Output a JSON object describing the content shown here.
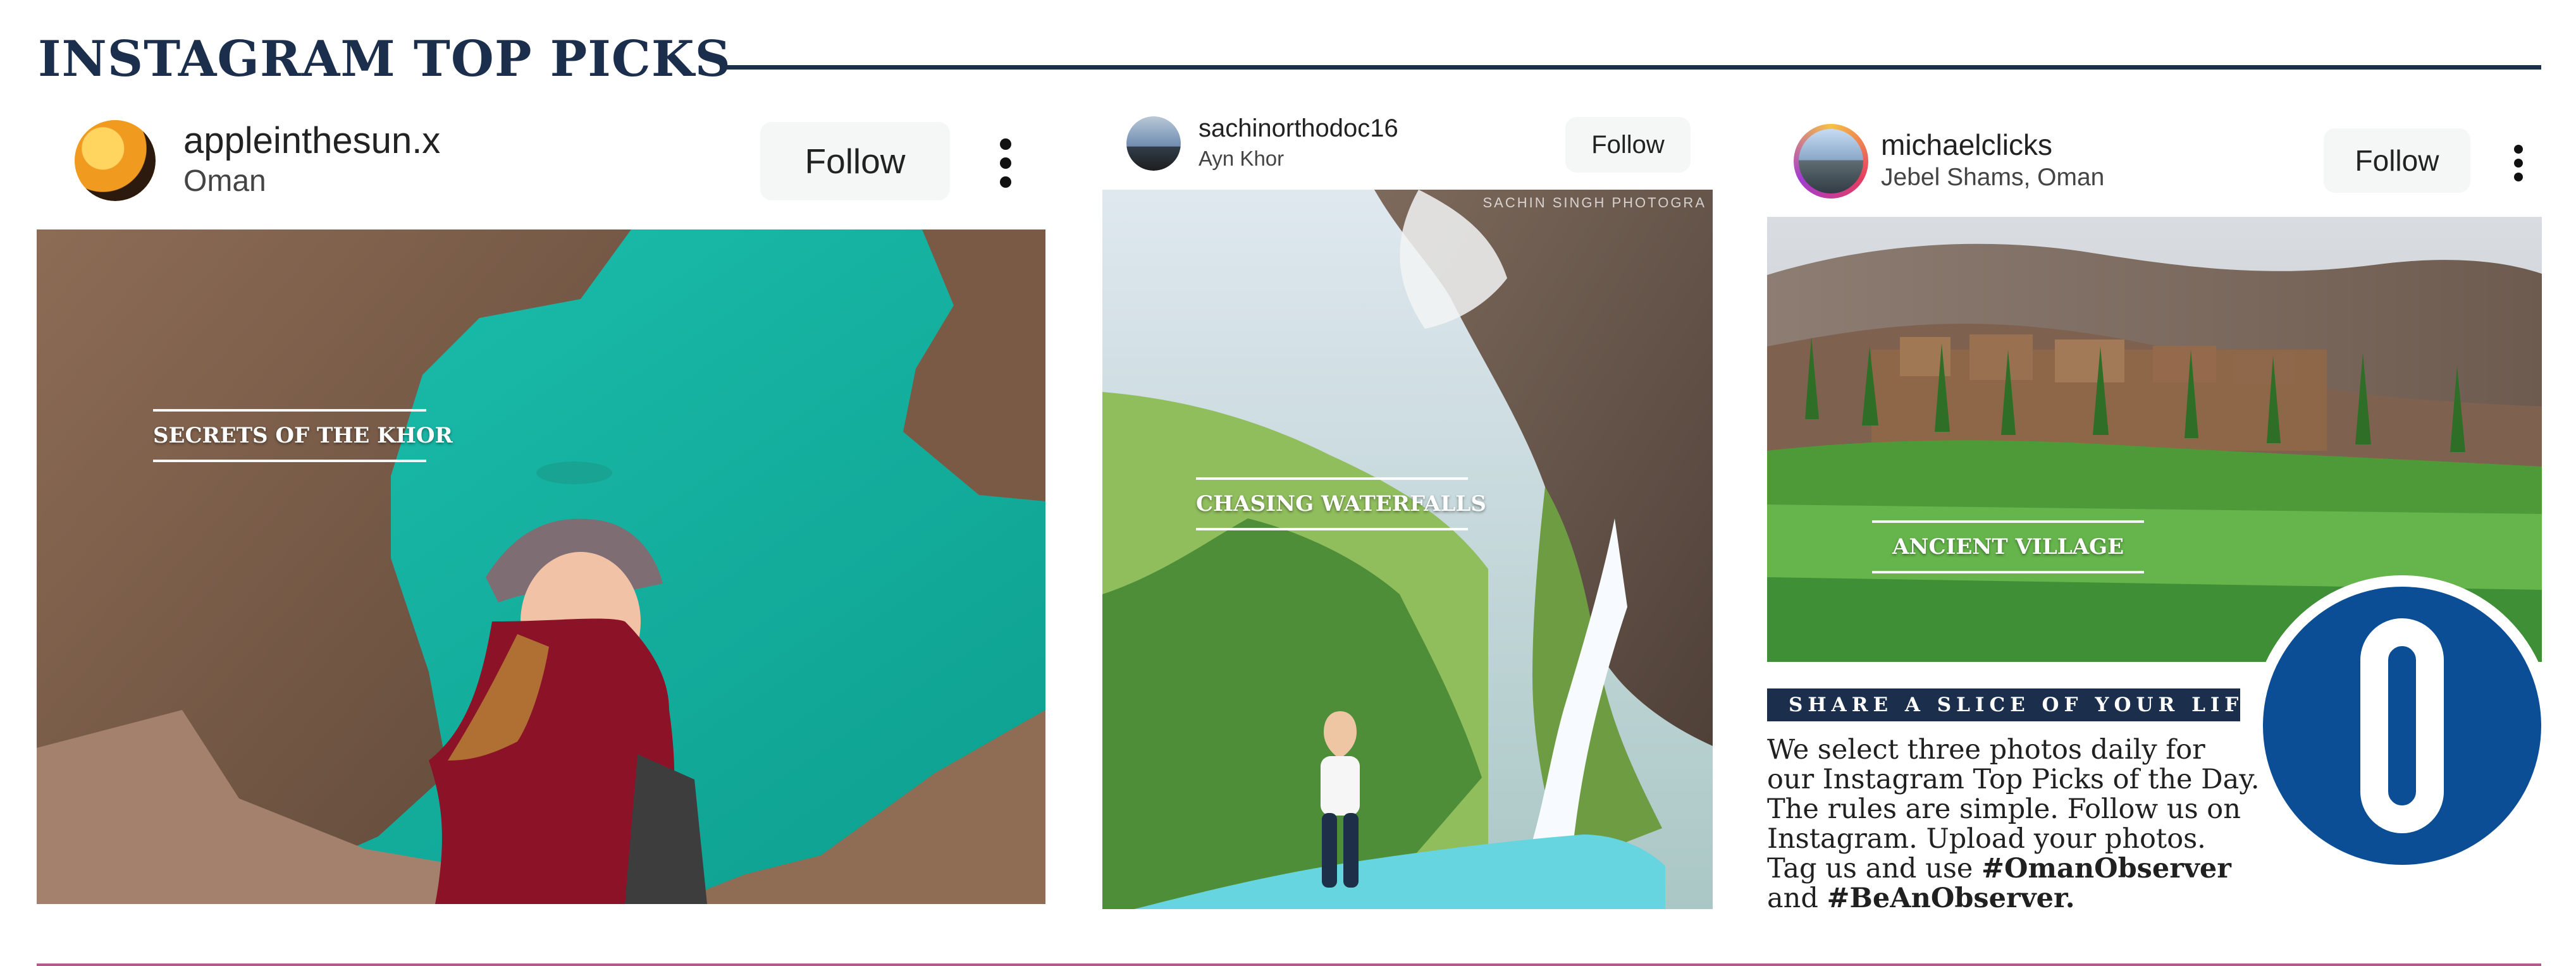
{
  "page": {
    "title": "INSTAGRAM TOP PICKS"
  },
  "posts": [
    {
      "username": "appleinthesun.x",
      "location": "Oman",
      "follow_label": "Follow",
      "overlay_label": "SECRETS OF THE KHOR",
      "colors": {
        "water": "#21b7a4",
        "rock": "#6f5542"
      }
    },
    {
      "username": "sachinorthodoc16",
      "location": "Ayn Khor",
      "follow_label": "Follow",
      "overlay_label": "CHASING WATERFALLS",
      "watermark": "SACHIN SINGH PHOTOGRA",
      "colors": {
        "foliage": "#7fb34d",
        "pool": "#53c9d8"
      }
    },
    {
      "username": "michaelclicks",
      "location": "Jebel Shams, Oman",
      "follow_label": "Follow",
      "overlay_label": "ANCIENT VILLAGE",
      "colors": {
        "terraces": "#4fa53e",
        "ruins": "#8c6748"
      }
    }
  ],
  "promo": {
    "banner": "SHARE A SLICE OF YOUR LIFE",
    "description": "We select three photos daily for our Instagram Top Picks of the Day. The rules are simple. Follow us on Instagram. Upload your photos. Tag us and use",
    "hashtag_one": "#OmanObserver",
    "connector": "and",
    "hashtag_two": "#BeAnObserver."
  },
  "icons": {
    "more": "more-options-icon",
    "logo": "oman-observer-logo"
  },
  "colors": {
    "heading": "#1b2f4d",
    "footer_rule": "#b05c8b",
    "logo_blue": "#0b4e96"
  }
}
